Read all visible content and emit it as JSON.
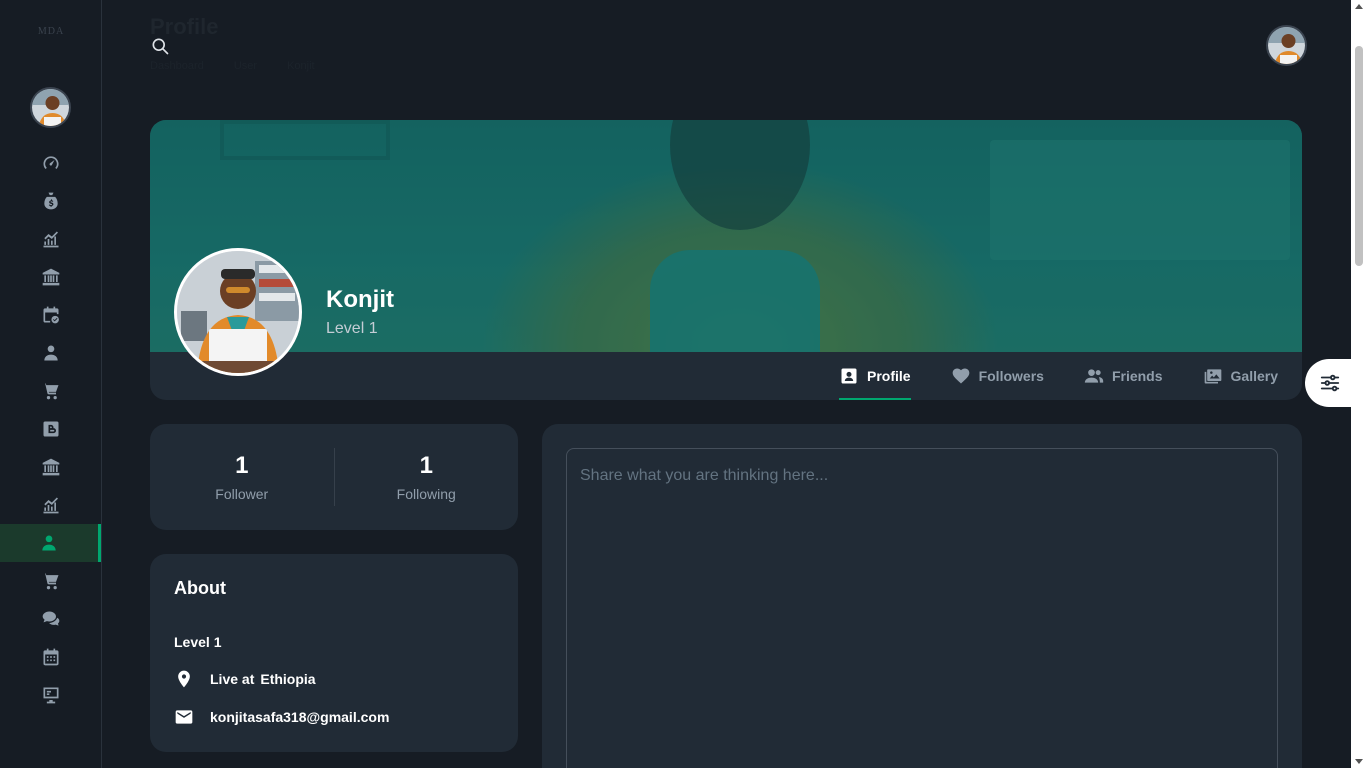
{
  "header": {
    "ghost_title": "Profile",
    "ghost_crumbs": [
      "Dashboard",
      "User",
      "Konjit"
    ],
    "search_icon": "search-icon"
  },
  "sidebar": {
    "logo": "MDA",
    "items": [
      {
        "icon": "dashboard-icon",
        "active": false
      },
      {
        "icon": "money-bag-icon",
        "active": false
      },
      {
        "icon": "analytics-icon",
        "active": false
      },
      {
        "icon": "bank-icon",
        "active": false
      },
      {
        "icon": "calendar-check-icon",
        "active": false
      },
      {
        "icon": "user-icon",
        "active": false
      },
      {
        "icon": "cart-icon",
        "active": false
      },
      {
        "icon": "blog-icon",
        "active": false
      },
      {
        "icon": "bank-icon",
        "active": false
      },
      {
        "icon": "analytics-icon",
        "active": false
      },
      {
        "icon": "user-icon",
        "active": true
      },
      {
        "icon": "cart-icon",
        "active": false
      },
      {
        "icon": "chat-icon",
        "active": false
      },
      {
        "icon": "calendar-icon",
        "active": false
      },
      {
        "icon": "kanban-icon",
        "active": false
      }
    ]
  },
  "profile": {
    "name": "Konjit",
    "level": "Level 1"
  },
  "tabs": [
    {
      "label": "Profile",
      "icon": "profile-card-icon",
      "active": true
    },
    {
      "label": "Followers",
      "icon": "heart-icon",
      "active": false
    },
    {
      "label": "Friends",
      "icon": "users-icon",
      "active": false
    },
    {
      "label": "Gallery",
      "icon": "gallery-icon",
      "active": false
    }
  ],
  "stats": {
    "followers_count": "1",
    "followers_label": "Follower",
    "following_count": "1",
    "following_label": "Following"
  },
  "about": {
    "title": "About",
    "level": "Level 1",
    "live_prefix": "Live at",
    "location": "Ethiopia",
    "email": "konjitasafa318@gmail.com"
  },
  "post": {
    "placeholder": "Share what you are thinking here..."
  },
  "colors": {
    "accent": "#00a76f",
    "background": "#161c24",
    "card": "#212b36"
  }
}
